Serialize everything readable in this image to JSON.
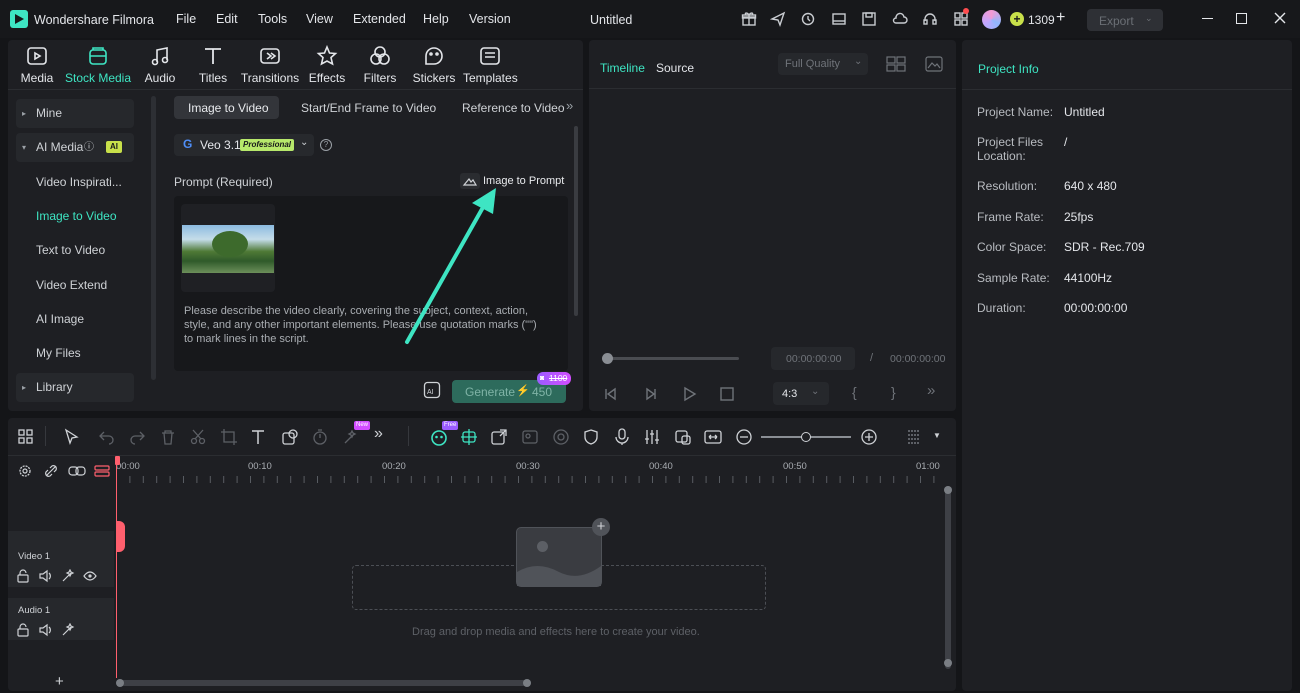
{
  "app": {
    "title": "Wondershare Filmora",
    "document": "Untitled"
  },
  "menu": [
    "File",
    "Edit",
    "Tools",
    "View",
    "Extended",
    "Help",
    "Version"
  ],
  "credits": "1309",
  "export_label": "Export",
  "toolbar": [
    {
      "label": "Media",
      "icon": "media-icon"
    },
    {
      "label": "Stock Media",
      "icon": "stock-media-icon"
    },
    {
      "label": "Audio",
      "icon": "audio-icon"
    },
    {
      "label": "Titles",
      "icon": "titles-icon"
    },
    {
      "label": "Transitions",
      "icon": "transitions-icon"
    },
    {
      "label": "Effects",
      "icon": "effects-icon"
    },
    {
      "label": "Filters",
      "icon": "filters-icon"
    },
    {
      "label": "Stickers",
      "icon": "stickers-icon"
    },
    {
      "label": "Templates",
      "icon": "templates-icon"
    }
  ],
  "sidebar": {
    "mine": "Mine",
    "ai_media": "AI Media",
    "ai_badge": "AI",
    "items": [
      "Video Inspirati...",
      "Image to Video",
      "Text to Video",
      "Video Extend",
      "AI Image",
      "My Files"
    ],
    "library": "Library"
  },
  "subtabs": [
    "Image to Video",
    "Start/End Frame to Video",
    "Reference to Video"
  ],
  "model": {
    "name": "Veo 3.1",
    "badge": "Professional"
  },
  "prompt": {
    "label": "Prompt (Required)",
    "image_to_prompt": "Image to Prompt",
    "placeholder_line1": "Please describe the video clearly, covering the subject, context, action,",
    "placeholder_line2": "style, and any other important elements. Please use quotation marks (\"\")",
    "placeholder_line3": "to mark lines in the script."
  },
  "generate": {
    "label": "Generate",
    "cost": "450",
    "old_cost": "1100"
  },
  "preview": {
    "tab_timeline": "Timeline",
    "tab_source": "Source",
    "quality": "Full Quality",
    "time_current": "00:00:00:00",
    "time_sep": "/",
    "time_total": "00:00:00:00",
    "aspect": "4:3"
  },
  "project_info": {
    "title": "Project Info",
    "rows": [
      {
        "label": "Project Name:",
        "value": "Untitled"
      },
      {
        "label": "Project Files Location:",
        "value": "/"
      },
      {
        "label": "Resolution:",
        "value": "640 x 480"
      },
      {
        "label": "Frame Rate:",
        "value": "25fps"
      },
      {
        "label": "Color Space:",
        "value": "SDR - Rec.709"
      },
      {
        "label": "Sample Rate:",
        "value": "44100Hz"
      },
      {
        "label": "Duration:",
        "value": "00:00:00:00"
      }
    ]
  },
  "timeline": {
    "ruler": [
      "00:00",
      "00:10",
      "00:20",
      "00:30",
      "00:40",
      "00:50",
      "01:00"
    ],
    "video_track": "Video 1",
    "audio_track": "Audio 1",
    "drop_hint": "Drag and drop media and effects here to create your video.",
    "new_badge": "New",
    "free_badge": "Free",
    "zoom_level": 0.5
  },
  "colors": {
    "accent": "#3ee5c3",
    "bg": "#141518",
    "panel": "#1e1f23"
  }
}
